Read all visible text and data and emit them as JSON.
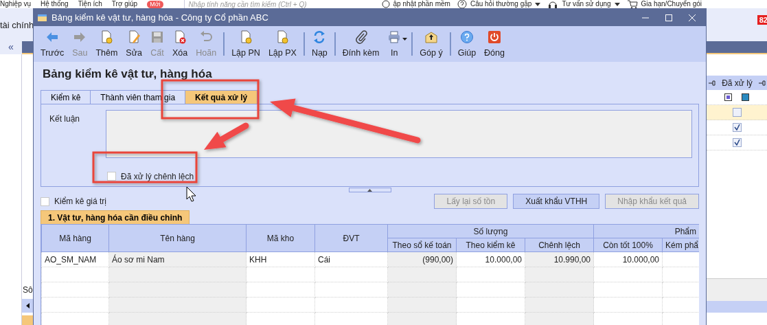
{
  "background_app": {
    "menu": [
      {
        "label": "Nghiệp vụ"
      },
      {
        "label": "Hệ thống"
      },
      {
        "label": "Tiện ích"
      },
      {
        "label": "Trợ giúp"
      }
    ],
    "new_badge": "Mới",
    "search": {
      "placeholder": "Nhập tính năng cần tìm kiếm (Ctrl + Q)"
    },
    "links": [
      {
        "label": "ập nhật phần mềm",
        "kind": "radio",
        "dropdown": false
      },
      {
        "label": "Câu hỏi thường gặp",
        "kind": "help",
        "dropdown": true
      },
      {
        "label": "Tư vấn sử dụng",
        "kind": "support",
        "dropdown": true
      },
      {
        "label": "Gia hạn/Chuyển gói",
        "kind": "cart",
        "dropdown": false
      }
    ],
    "module_label": "tài chính",
    "collapse": "«",
    "notification_count": "82",
    "side_label": "Sô",
    "side_grid": {
      "column": "Đã xử lý",
      "rows": [
        {
          "checked": false,
          "selected": true
        },
        {
          "checked": true,
          "selected": false
        },
        {
          "checked": true,
          "selected": false
        }
      ]
    }
  },
  "dialog": {
    "title": "Bảng kiểm kê vật tư, hàng hóa - Công ty Cổ phần ABC",
    "toolbar": [
      {
        "label": "Trước",
        "kind": "back",
        "disabled": false,
        "group_start": false
      },
      {
        "label": "Sau",
        "kind": "forward",
        "disabled": true,
        "group_start": false
      },
      {
        "label": "Thêm",
        "kind": "new",
        "disabled": false,
        "group_start": false
      },
      {
        "label": "Sửa",
        "kind": "edit",
        "disabled": false,
        "group_start": false
      },
      {
        "label": "Cất",
        "kind": "save",
        "disabled": true,
        "group_start": false
      },
      {
        "label": "Xóa",
        "kind": "delete",
        "disabled": false,
        "group_start": false
      },
      {
        "label": "Hoãn",
        "kind": "undo",
        "disabled": true,
        "group_start": false
      },
      {
        "label": "Lập PN",
        "kind": "new",
        "disabled": false,
        "group_start": true
      },
      {
        "label": "Lập PX",
        "kind": "new",
        "disabled": false,
        "group_start": false
      },
      {
        "label": "Nạp",
        "kind": "refresh",
        "disabled": false,
        "group_start": true
      },
      {
        "label": "Đính kèm",
        "kind": "attach",
        "disabled": false,
        "group_start": true
      },
      {
        "label": "In",
        "kind": "print",
        "disabled": false,
        "group_start": false,
        "dropdown": true
      },
      {
        "label": "Góp ý",
        "kind": "feedback",
        "disabled": false,
        "group_start": true
      },
      {
        "label": "Giúp",
        "kind": "help",
        "disabled": false,
        "group_start": true
      },
      {
        "label": "Đóng",
        "kind": "close",
        "disabled": false,
        "group_start": false
      }
    ],
    "heading": "Bảng kiểm kê vật tư, hàng hóa",
    "tabs": [
      {
        "label": "Kiểm kê",
        "selected": false
      },
      {
        "label": "Thành viên tham gia",
        "selected": false
      },
      {
        "label": "Kết quả xử lý",
        "selected": true
      }
    ],
    "conclusion_label": "Kết luận",
    "processed": {
      "label": "Đã xử lý chênh lệch",
      "checked": false
    },
    "value_count": {
      "label": "Kiểm kê giá trị",
      "checked": false
    },
    "actions": [
      {
        "label": "Lấy lại số tồn",
        "disabled": true
      },
      {
        "label": "Xuất khẩu VTHH",
        "disabled": false
      },
      {
        "label": "Nhập khẩu kết quả",
        "disabled": true
      }
    ],
    "grid_tab": {
      "label": "1. Vật tư, hàng hóa cần điều chỉnh",
      "selected": true
    },
    "table": {
      "columns": [
        {
          "label": "Mã hàng",
          "kind": "text",
          "readonly": false
        },
        {
          "label": "Tên hàng",
          "kind": "text",
          "readonly": true
        },
        {
          "label": "Mã kho",
          "kind": "text",
          "readonly": false
        },
        {
          "label": "ĐVT",
          "kind": "text",
          "readonly": false
        },
        {
          "group": "Số lượng",
          "colspan": 3,
          "children": [
            {
              "label": "Theo sổ kế toán",
              "kind": "number",
              "readonly": true
            },
            {
              "label": "Theo kiểm kê",
              "kind": "number",
              "readonly": false
            },
            {
              "label": "Chênh lệch",
              "kind": "number",
              "readonly": true
            }
          ]
        },
        {
          "group": "Phẩm",
          "colspan": 2,
          "children": [
            {
              "label": "Còn tốt 100%",
              "kind": "number",
              "readonly": false
            },
            {
              "label": "Kém phẩ",
              "kind": "number",
              "readonly": false
            }
          ]
        }
      ],
      "rows": [
        {
          "cells": [
            "AO_SM_NAM",
            "Áo sơ mi Nam",
            "KHH",
            "Cái",
            "(990,00)",
            "10.000,00",
            "10.990,00",
            "10.000,00"
          ]
        }
      ]
    }
  }
}
